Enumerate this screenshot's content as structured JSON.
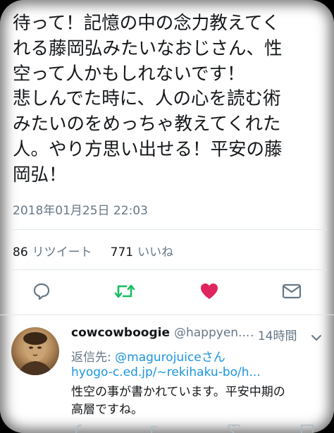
{
  "tweet": {
    "lines": [
      "待って！記憶の中の念力教えてく",
      "れる藤岡弘みたいなおじさん、性",
      "空って人かもしれないです！",
      "悲しんでた時に、人の心を読む術",
      "みたいのをめっちゃ教えてくれた",
      "人。やり方思い出せる！平安の藤",
      "岡弘！"
    ],
    "timestamp": "2018年01月25日 22:03"
  },
  "stats": {
    "retweet_count": "86",
    "retweet_label": "リツイート",
    "like_count": "771",
    "like_label": "いいね"
  },
  "actions": {
    "icons": [
      "reply-icon",
      "retweet-icon",
      "like-icon",
      "message-icon"
    ],
    "colors": {
      "reply": "#657786",
      "retweet": "#17bf63",
      "like": "#e0245e",
      "message": "#657786"
    }
  },
  "reply": {
    "name": "cowcowboogie",
    "handle": "@happyen...",
    "dot": "·",
    "time": "14時間",
    "reply_to_label": "返信先:",
    "reply_to_link": "@magurojuiceさん",
    "link": "hyogo-c.ed.jp/~rekihaku-bo/h...",
    "body_lines": [
      "性空の事が書かれています。平安中期の",
      "高層ですね。"
    ]
  }
}
